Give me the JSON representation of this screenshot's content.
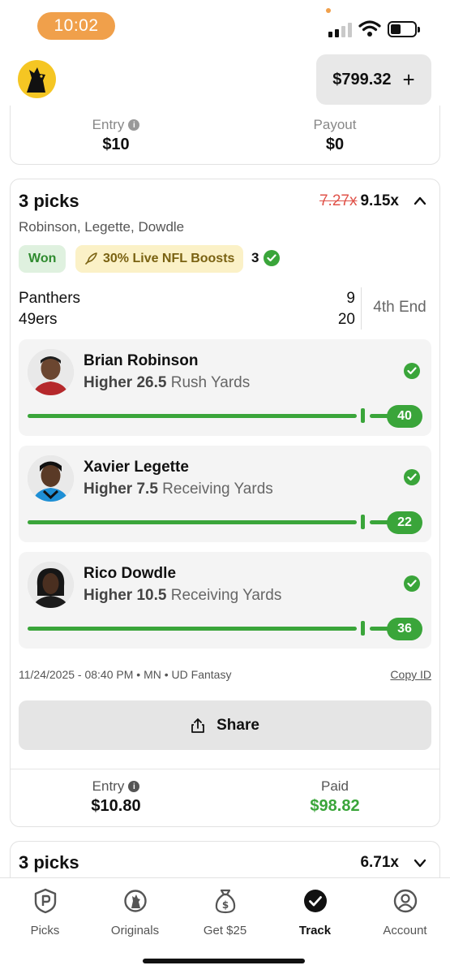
{
  "status_bar": {
    "time": "10:02",
    "battery_level": 0.35
  },
  "header": {
    "balance": "$799.32",
    "add_funds_symbol": "+",
    "logo_icon": "underdog-logo-icon"
  },
  "previous_entry": {
    "entry_label": "Entry",
    "entry_value": "$10",
    "payout_label": "Payout",
    "payout_value": "$0"
  },
  "entry_card": {
    "title": "3 picks",
    "old_multiplier": "7.27x",
    "new_multiplier": "9.15x",
    "players": "Robinson, Legette, Dowdle",
    "status_badge": "Won",
    "boost_badge": "30% Live NFL Boosts",
    "correct_count": "3",
    "game": {
      "team1": "Panthers",
      "score1": "9",
      "team2": "49ers",
      "score2": "20",
      "period": "4th End"
    },
    "picks": [
      {
        "name": "Brian Robinson",
        "direction": "Higher",
        "line": "26.5",
        "stat": "Rush Yards",
        "result": "40",
        "line_fraction": 0.96
      },
      {
        "name": "Xavier Legette",
        "direction": "Higher",
        "line": "7.5",
        "stat": "Receiving Yards",
        "result": "22",
        "line_fraction": 0.96
      },
      {
        "name": "Rico Dowdle",
        "direction": "Higher",
        "line": "10.5",
        "stat": "Receiving Yards",
        "result": "36",
        "line_fraction": 0.96
      }
    ],
    "meta": "11/24/2025 - 08:40 PM • MN • UD Fantasy",
    "copy_id": "Copy ID",
    "share_label": "Share",
    "entry_label": "Entry",
    "entry_value": "$10.80",
    "paid_label": "Paid",
    "paid_value": "$98.82"
  },
  "next_card": {
    "title": "3 picks",
    "multiplier": "6.71x"
  },
  "tabs": [
    {
      "label": "Picks",
      "icon": "picks-icon"
    },
    {
      "label": "Originals",
      "icon": "originals-icon"
    },
    {
      "label": "Get $25",
      "icon": "money-bag-icon"
    },
    {
      "label": "Track",
      "icon": "track-check-icon",
      "active": true
    },
    {
      "label": "Account",
      "icon": "account-icon"
    }
  ],
  "colors": {
    "accent_green": "#3aa53a",
    "won_bg": "#dff1df",
    "boost_bg": "#fbf1c7",
    "strike_red": "#e0534a",
    "time_pill": "#f0a04b",
    "logo_yellow": "#f5c623"
  }
}
